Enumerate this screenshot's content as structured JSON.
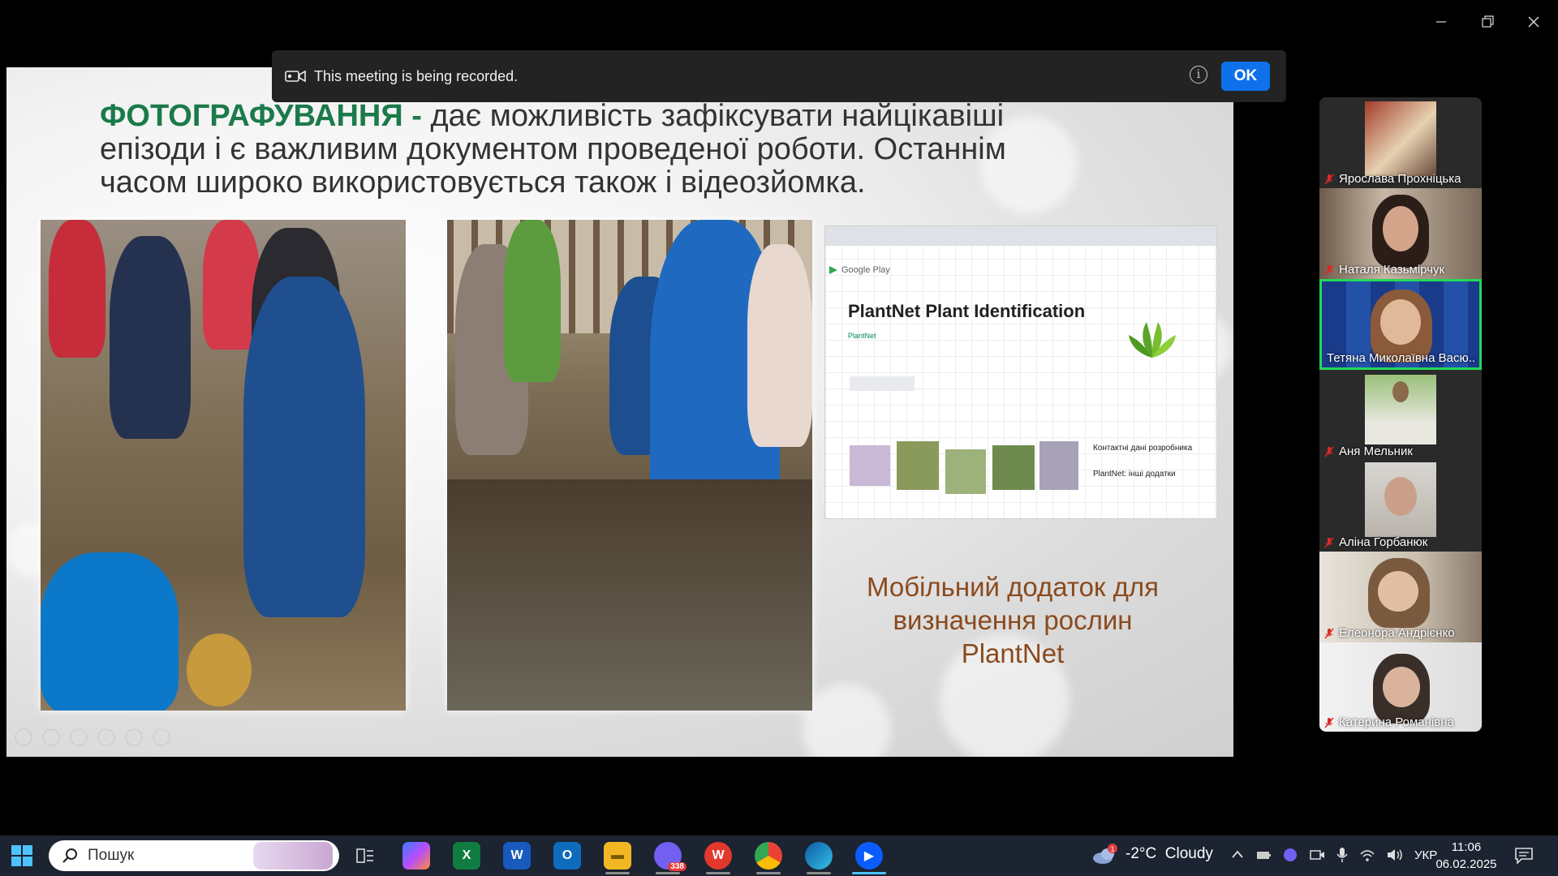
{
  "recording_banner": {
    "text": "This meeting is being recorded.",
    "ok_label": "OK"
  },
  "slide": {
    "heading_highlight": "ФОТОГРАФУВАННЯ -",
    "heading_rest": " дає можливість зафіксувати найцікавіші епізоди і є важливим документом проведеної роботи. Останнім часом широко використовується також і відеозйомка.",
    "caption": "Мобільний додаток для визначення рослин PlantNet",
    "screenshot": {
      "store": "Google Play",
      "app_title": "PlantNet Plant Identification",
      "developer": "PlantNet",
      "contacts": "Контактні дані розробника",
      "other_apps": "PlantNet: інші додатки"
    }
  },
  "participants": [
    {
      "name": "Ярослава Прохніцька",
      "muted": true
    },
    {
      "name": "Наталя Казьмірчук",
      "muted": true
    },
    {
      "name": "Тетяна Миколаївна Васю...",
      "muted": false,
      "active": true
    },
    {
      "name": "Аня Мельник",
      "muted": true
    },
    {
      "name": "Аліна Горбанюк",
      "muted": true
    },
    {
      "name": "Елеонора Андрієнко",
      "muted": true
    },
    {
      "name": "Катерина Романівна",
      "muted": true
    }
  ],
  "taskbar": {
    "search_placeholder": "Пошук",
    "viber_badge": "338",
    "weather": "-2°C  Cloudy",
    "weather_alert": "1",
    "language": "УКР",
    "time": "11:06",
    "date": "06.02.2025"
  },
  "colors": {
    "accent_ok": "#0e71eb",
    "active_speaker": "#23d959",
    "heading_green": "#1b7a4a",
    "caption_brown": "#8a4a1e"
  }
}
